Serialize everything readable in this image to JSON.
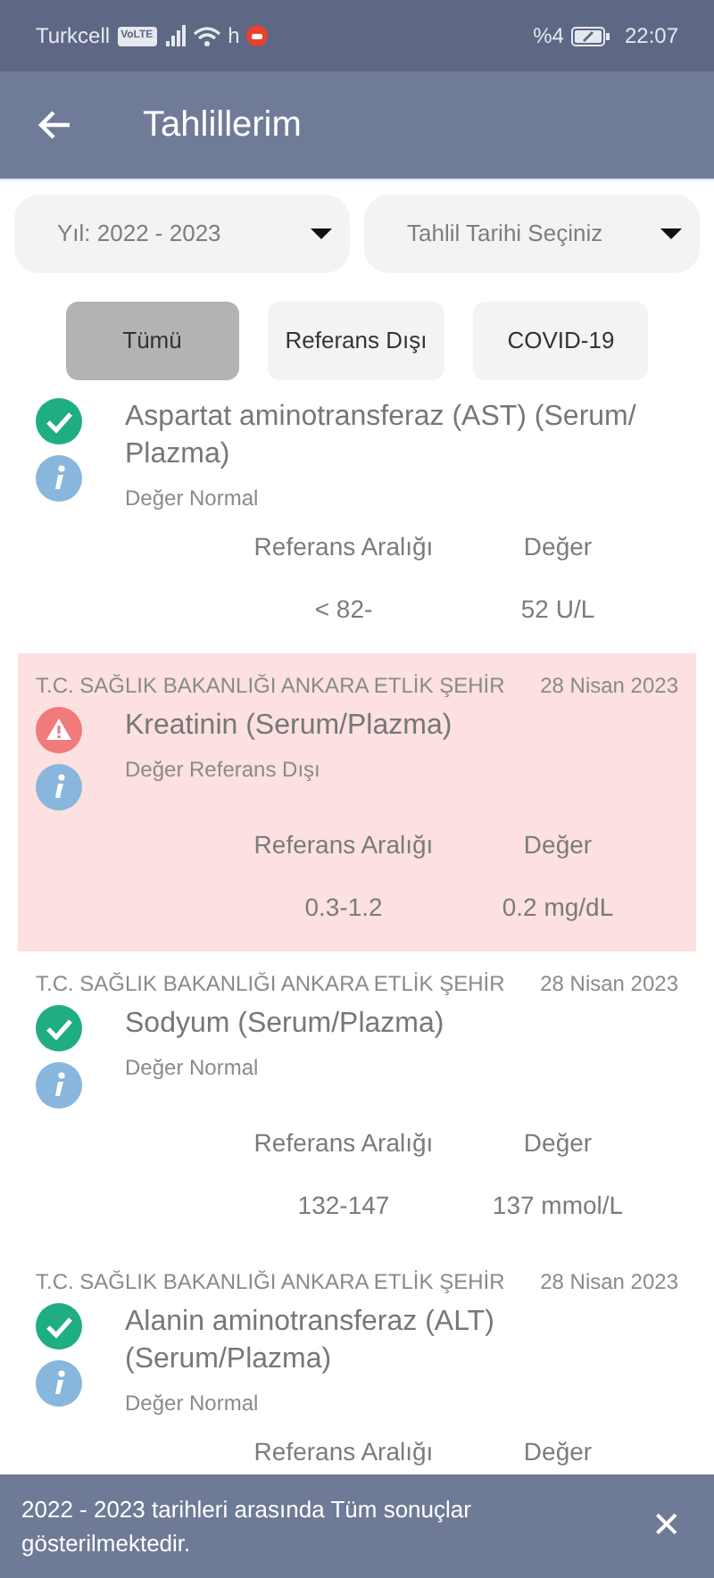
{
  "status_bar": {
    "carrier": "Turkcell",
    "volte": "VoLTE",
    "network": "h",
    "battery_text": "%4",
    "time": "22:07"
  },
  "app_bar": {
    "title": "Tahlillerim"
  },
  "filters": [
    {
      "value": "Yıl: 2022 - 2023"
    },
    {
      "value": "Tahlil Tarihi Seçiniz"
    }
  ],
  "chips": [
    {
      "label": "Tümü",
      "selected": true
    },
    {
      "label": "Referans Dışı",
      "selected": false
    },
    {
      "label": "COVID-19",
      "selected": false
    }
  ],
  "results": [
    {
      "kind": "normal",
      "name": "Aspartat aminotransferaz (AST) (Serum/ Plazma)",
      "status_text": "Değer Normal",
      "range_label": "Referans Aralığı",
      "value_label": "Değer",
      "range": "< 82-",
      "value": "52 U/L"
    },
    {
      "kind": "out_of_range",
      "hospital": "T.C. SAĞLIK BAKANLIĞI ANKARA ETLİK ŞEHİR",
      "date": "28 Nisan 2023",
      "name": "Kreatinin (Serum/Plazma)",
      "status_text": "Değer Referans Dışı",
      "range_label": "Referans Aralığı",
      "value_label": "Değer",
      "range": "0.3-1.2",
      "value": "0.2 mg/dL"
    },
    {
      "kind": "normal",
      "hospital": "T.C. SAĞLIK BAKANLIĞI ANKARA ETLİK ŞEHİR",
      "date": "28 Nisan 2023",
      "name": "Sodyum (Serum/Plazma)",
      "status_text": "Değer Normal",
      "range_label": "Referans Aralığı",
      "value_label": "Değer",
      "range": "132-147",
      "value": "137 mmol/L"
    },
    {
      "kind": "normal",
      "hospital": "T.C. SAĞLIK BAKANLIĞI ANKARA ETLİK ŞEHİR",
      "date": "28 Nisan 2023",
      "name": "Alanin aminotransferaz (ALT) (Serum/Plazma)",
      "status_text": "Değer Normal",
      "range_label": "Referans Aralığı",
      "value_label": "Değer"
    }
  ],
  "snackbar": {
    "message": "2022 - 2023 tarihleri arasında Tüm sonuçlar gösterilmektedir.",
    "close": "✕"
  }
}
